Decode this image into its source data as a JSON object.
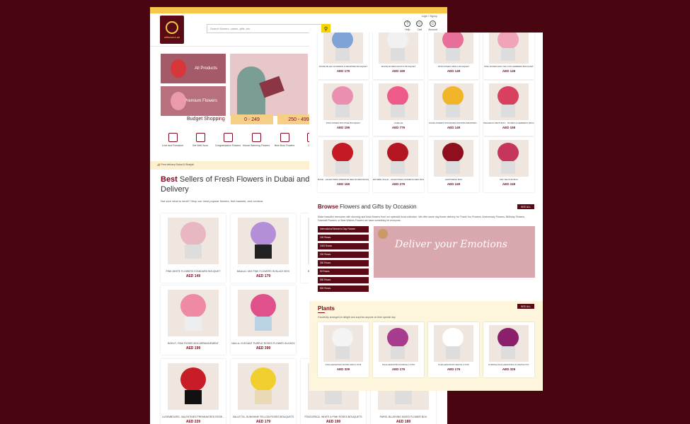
{
  "left": {
    "login": "Login / Signup",
    "search_placeholder": "Search flowers, cakes, gifts, etc.",
    "header_icons": [
      {
        "icon": "help-icon",
        "label": "Help"
      },
      {
        "icon": "cart-icon",
        "label": "Cart"
      },
      {
        "icon": "account-icon",
        "label": "Account"
      }
    ],
    "brand": "ukflowers.ae",
    "banners": {
      "all_products": "All Products",
      "premium": "Premium Flowers"
    },
    "budget": {
      "label": "Budget Shopping",
      "chips": [
        "0 - 249",
        "250 - 499"
      ]
    },
    "categories": [
      "Love and Romance",
      "Get Well Soon",
      "Congratulation Flowers",
      "House Warming Flowers",
      "New Born Flowers",
      "Deals"
    ],
    "strip": "Free delivery Dubai & Sharjah",
    "heading_bold": "Best",
    "heading_rest": " Sellers of Fresh Flowers in Dubai and acr",
    "heading_line2": "Delivery",
    "subtext": "Not sure what to send? Shop our most popular flowers, fruit baskets, and combos.",
    "products": [
      {
        "name": "PINK WHITE FLOWERS STANDARD BOUQUET",
        "price": "AED 149",
        "color": "#e8b7c2"
      },
      {
        "name": "BAALAJ- MIX PINK FLOWERS IN BLACK BOX",
        "price": "AED 179",
        "color": "#b48ed6"
      },
      {
        "name": "BOKUT- PINK ROSES BOX ARRANGEMENT",
        "price": "AED 199",
        "color": "#ef8aa4"
      },
      {
        "name": "NALLA- ELEGANT PURPLE ROSES FLOWER IN A BOX",
        "price": "AED 399",
        "color": "#e0508a"
      },
      {
        "name": "LUXEMBOURG- VALENTINES PREMIUM RED ROSE...",
        "price": "AED 229",
        "color": "#c81d26"
      },
      {
        "name": "VALLETTA- SUNSHINE YELLOW ROSES BOUQUETS",
        "price": "AED 179",
        "color": "#f0cf2e"
      },
      {
        "name": "PODGORICA- WHITE & PINK ROSES BOUQUETS",
        "price": "AED 199",
        "color": "#efc1cb"
      },
      {
        "name": "PARIS- BLUSHING MIXED FLOWER BOX",
        "price": "AED 189",
        "color": "#dca0b3"
      }
    ]
  },
  "right": {
    "products": [
      {
        "name": "WHITE BLUE FLOWERS & WRAPPER BOUQUET",
        "price": "AED 179",
        "color": "#7fa3d6"
      },
      {
        "name": "WHITE ROSES EXOTIC BOUQUET",
        "price": "AED 169",
        "color": "#f1f1f1"
      },
      {
        "name": "PINK ROSES SMALL BOUQUET",
        "price": "AED 149",
        "color": "#e76f9a"
      },
      {
        "name": "PINK ROSES AND YELLOW GERBERA BOUQUET",
        "price": "AED 149",
        "color": "#f1a3b8"
      },
      {
        "name": "PINK ROSES ROUTINE BOUQUET",
        "price": "AED 199",
        "color": "#ea8fb0"
      },
      {
        "name": "CAMILLE",
        "price": "AED 779",
        "color": "#ee5a8a"
      },
      {
        "name": "SUNFLOWERS STANDARD DROPPA WRAPPED...",
        "price": "AED 149",
        "color": "#f0b529"
      },
      {
        "name": "PEACEFUL BIRTHDAY - ROSES & FERRERO ROCHER...",
        "price": "AED 159",
        "color": "#d94060"
      },
      {
        "name": "BAKE - VALENTINES PREMIUM RED ROSES BOUQUET",
        "price": "AED 169",
        "color": "#c31a23"
      },
      {
        "name": "ENTRÉE VALLE - VALENTINES SUMMON RED ROSES",
        "price": "AED 279",
        "color": "#b51722"
      },
      {
        "name": "HAPPINESS BOX",
        "price": "AED 249",
        "color": "#8f0f1e"
      },
      {
        "name": "MIX VELOUR BOX",
        "price": "AED 249",
        "color": "#c6365a"
      }
    ],
    "occasion": {
      "title_bold": "Browse",
      "title_rest": " Flowers and Gifts by Occasion",
      "see_all": "SEE ALL",
      "desc": "Make beautiful memories with stunning and fresh flowers from our splendid floral collection. We offer same day flower delivery for Thank You Flowers, Anniversary Flowers, Birthday Flowers, Farewell Flowers, or Best Wishes Flowers we have something for everyone.",
      "items": [
        "International Women's Day Flowers",
        "100 Roses",
        "1000 Roses",
        "200 Roses",
        "300 Roses",
        "50 Roses",
        "500 Roses",
        "800 Roses"
      ],
      "image_text": "Deliver your Emotions"
    },
    "plants": {
      "title": "Plants",
      "see_all": "SEE ALL",
      "subtitle": "Gracefully arranged to delight and surprise anyone on their special day",
      "items": [
        {
          "name": "PHALAENOPSIS WHITE MINI 2 STM",
          "price": "AED 329",
          "color": "#f4f4f4"
        },
        {
          "name": "PHALAENOPSIS PURPLE 2 STM",
          "price": "AED 175",
          "color": "#a83b8d"
        },
        {
          "name": "PHALAENOPSIS WHITE 2 STM",
          "price": "AED 175",
          "color": "#ffffff"
        },
        {
          "name": "PURPLE PHALAENOPSIS IN WHITE POT",
          "price": "AED 329",
          "color": "#8c1f6c"
        }
      ]
    }
  },
  "colors": {
    "brand": "#5a0a14",
    "accent": "#f5c84c",
    "background": "#4a0610",
    "price": "#7a0a1c"
  }
}
